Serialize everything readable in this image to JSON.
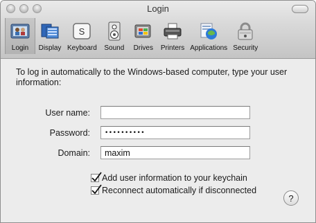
{
  "window": {
    "title": "Login"
  },
  "toolbar": {
    "items": [
      {
        "label": "Login",
        "icon": "login-icon",
        "active": true
      },
      {
        "label": "Display",
        "icon": "display-icon"
      },
      {
        "label": "Keyboard",
        "icon": "keyboard-icon",
        "glyph": "S"
      },
      {
        "label": "Sound",
        "icon": "sound-icon"
      },
      {
        "label": "Drives",
        "icon": "drives-icon"
      },
      {
        "label": "Printers",
        "icon": "printers-icon"
      },
      {
        "label": "Applications",
        "icon": "applications-icon"
      },
      {
        "label": "Security",
        "icon": "security-icon"
      }
    ]
  },
  "form": {
    "intro": "To log in automatically to the Windows-based computer, type your user information:",
    "username_label": "User name:",
    "username_value": "",
    "password_label": "Password:",
    "password_value": "••••••••••",
    "domain_label": "Domain:",
    "domain_value": "maxim",
    "keychain_label": "Add user information to your keychain",
    "keychain_checked": true,
    "reconnect_label": "Reconnect automatically if disconnected",
    "reconnect_checked": true
  },
  "help": {
    "glyph": "?"
  },
  "colors": {
    "accent": "#2b6dd1"
  }
}
